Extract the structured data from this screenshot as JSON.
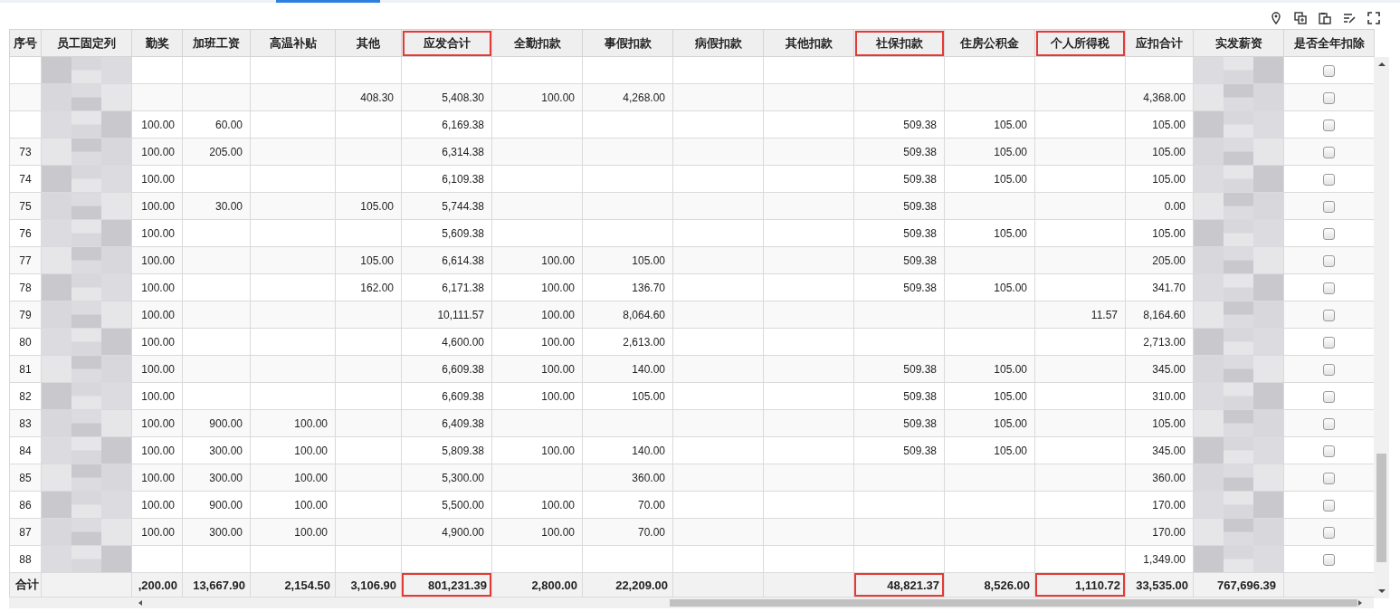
{
  "toolbar": {
    "active_tab_indicator": true
  },
  "columns": [
    {
      "label": "序号",
      "kind": "text",
      "highlighted": false,
      "total": "合计"
    },
    {
      "label": "员工固定列",
      "kind": "blurred",
      "highlighted": false
    },
    {
      "label": "勤奖",
      "kind": "number",
      "highlighted": false,
      "total": ",200.00"
    },
    {
      "label": "加班工资",
      "kind": "number",
      "highlighted": false,
      "total": "13,667.90"
    },
    {
      "label": "高温补贴",
      "kind": "number",
      "highlighted": false,
      "total": "2,154.50"
    },
    {
      "label": "其他",
      "kind": "number",
      "highlighted": false,
      "total": "3,106.90"
    },
    {
      "label": "应发合计",
      "kind": "number",
      "highlighted": true,
      "total": "801,231.39"
    },
    {
      "label": "全勤扣款",
      "kind": "number",
      "highlighted": false,
      "total": "2,800.00"
    },
    {
      "label": "事假扣款",
      "kind": "number",
      "highlighted": false,
      "total": "22,209.00"
    },
    {
      "label": "病假扣款",
      "kind": "number",
      "highlighted": false
    },
    {
      "label": "其他扣款",
      "kind": "number",
      "highlighted": false
    },
    {
      "label": "社保扣款",
      "kind": "number",
      "highlighted": true,
      "total": "48,821.37"
    },
    {
      "label": "住房公积金",
      "kind": "number",
      "highlighted": false,
      "total": "8,526.00"
    },
    {
      "label": "个人所得税",
      "kind": "number",
      "highlighted": true,
      "total": "1,110.72"
    },
    {
      "label": "应扣合计",
      "kind": "number",
      "highlighted": false,
      "total": "33,535.00"
    },
    {
      "label": "实发薪资",
      "kind": "blurred",
      "highlighted": false,
      "total": "767,696.39"
    },
    {
      "label": "是否全年扣除",
      "kind": "checkbox",
      "highlighted": false
    }
  ],
  "rows": [
    {
      "checked": false,
      "cells": [
        null,
        null,
        null,
        null,
        null,
        null,
        null,
        null,
        null,
        null,
        null,
        null,
        null,
        null,
        null,
        null,
        null
      ]
    },
    {
      "checked": false,
      "cells": [
        null,
        null,
        null,
        null,
        null,
        "408.30",
        "5,408.30",
        "100.00",
        "4,268.00",
        null,
        null,
        null,
        null,
        null,
        "4,368.00",
        null,
        null
      ]
    },
    {
      "checked": false,
      "cells": [
        null,
        null,
        "100.00",
        "60.00",
        null,
        null,
        "6,169.38",
        null,
        null,
        null,
        null,
        "509.38",
        "105.00",
        null,
        "105.00",
        null,
        null
      ]
    },
    {
      "checked": false,
      "cells": [
        "73",
        null,
        "100.00",
        "205.00",
        null,
        null,
        "6,314.38",
        null,
        null,
        null,
        null,
        "509.38",
        "105.00",
        null,
        "105.00",
        null,
        null
      ]
    },
    {
      "checked": false,
      "cells": [
        "74",
        null,
        "100.00",
        null,
        null,
        null,
        "6,109.38",
        null,
        null,
        null,
        null,
        "509.38",
        "105.00",
        null,
        "105.00",
        null,
        null
      ]
    },
    {
      "checked": false,
      "cells": [
        "75",
        null,
        "100.00",
        "30.00",
        null,
        "105.00",
        "5,744.38",
        null,
        null,
        null,
        null,
        "509.38",
        null,
        null,
        "0.00",
        null,
        null
      ]
    },
    {
      "checked": false,
      "cells": [
        "76",
        null,
        "100.00",
        null,
        null,
        null,
        "5,609.38",
        null,
        null,
        null,
        null,
        "509.38",
        "105.00",
        null,
        "105.00",
        null,
        null
      ]
    },
    {
      "checked": false,
      "cells": [
        "77",
        null,
        "100.00",
        null,
        null,
        "105.00",
        "6,614.38",
        "100.00",
        "105.00",
        null,
        null,
        "509.38",
        null,
        null,
        "205.00",
        null,
        null
      ]
    },
    {
      "checked": false,
      "cells": [
        "78",
        null,
        "100.00",
        null,
        null,
        "162.00",
        "6,171.38",
        "100.00",
        "136.70",
        null,
        null,
        "509.38",
        "105.00",
        null,
        "341.70",
        null,
        null
      ]
    },
    {
      "checked": false,
      "cells": [
        "79",
        null,
        "100.00",
        null,
        null,
        null,
        "10,111.57",
        "100.00",
        "8,064.60",
        null,
        null,
        null,
        null,
        "11.57",
        "8,164.60",
        null,
        null
      ]
    },
    {
      "checked": false,
      "cells": [
        "80",
        null,
        "100.00",
        null,
        null,
        null,
        "4,600.00",
        "100.00",
        "2,613.00",
        null,
        null,
        null,
        null,
        null,
        "2,713.00",
        null,
        null
      ]
    },
    {
      "checked": false,
      "cells": [
        "81",
        null,
        "100.00",
        null,
        null,
        null,
        "6,609.38",
        "100.00",
        "140.00",
        null,
        null,
        "509.38",
        "105.00",
        null,
        "345.00",
        null,
        null
      ]
    },
    {
      "checked": false,
      "cells": [
        "82",
        null,
        "100.00",
        null,
        null,
        null,
        "6,609.38",
        "100.00",
        "105.00",
        null,
        null,
        "509.38",
        "105.00",
        null,
        "310.00",
        null,
        null
      ]
    },
    {
      "checked": false,
      "cells": [
        "83",
        null,
        "100.00",
        "900.00",
        "100.00",
        null,
        "6,409.38",
        null,
        null,
        null,
        null,
        "509.38",
        "105.00",
        null,
        "105.00",
        null,
        null
      ]
    },
    {
      "checked": false,
      "cells": [
        "84",
        null,
        "100.00",
        "300.00",
        "100.00",
        null,
        "5,809.38",
        "100.00",
        "140.00",
        null,
        null,
        "509.38",
        "105.00",
        null,
        "345.00",
        null,
        null
      ]
    },
    {
      "checked": false,
      "cells": [
        "85",
        null,
        "100.00",
        "300.00",
        "100.00",
        null,
        "5,300.00",
        null,
        "360.00",
        null,
        null,
        null,
        null,
        null,
        "360.00",
        null,
        null
      ]
    },
    {
      "checked": false,
      "cells": [
        "86",
        null,
        "100.00",
        "900.00",
        "100.00",
        null,
        "5,500.00",
        "100.00",
        "70.00",
        null,
        null,
        null,
        null,
        null,
        "170.00",
        null,
        null
      ]
    },
    {
      "checked": false,
      "cells": [
        "87",
        null,
        "100.00",
        "300.00",
        "100.00",
        null,
        "4,900.00",
        "100.00",
        "70.00",
        null,
        null,
        null,
        null,
        null,
        "170.00",
        null,
        null
      ]
    },
    {
      "checked": false,
      "cells": [
        "88",
        null,
        null,
        null,
        null,
        null,
        null,
        null,
        null,
        null,
        null,
        null,
        null,
        null,
        "1,349.00",
        null,
        null
      ]
    }
  ]
}
